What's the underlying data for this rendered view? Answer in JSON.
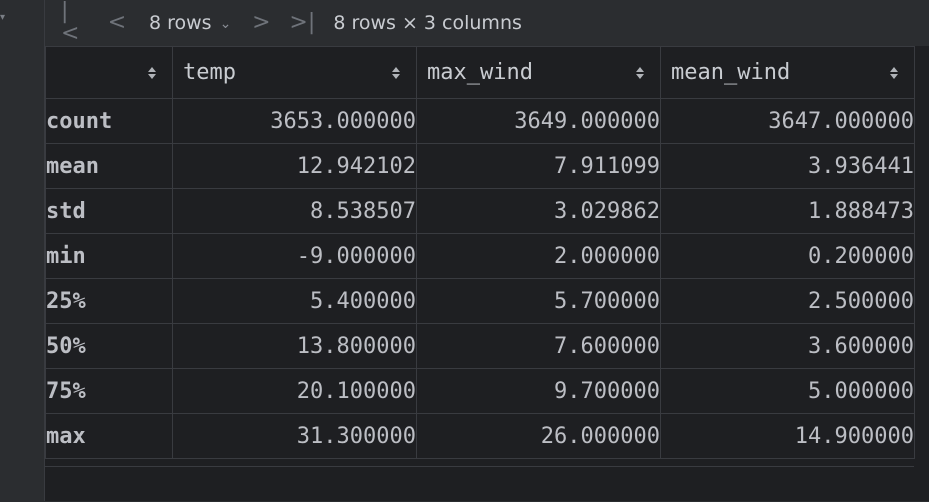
{
  "toolbar": {
    "first_icon": "|<",
    "prev_icon": "<",
    "rows_select": "8 rows",
    "next_icon": ">",
    "last_icon": ">|",
    "summary": "8 rows × 3 columns"
  },
  "table": {
    "columns": [
      "temp",
      "max_wind",
      "mean_wind"
    ],
    "rows": [
      {
        "label": "count",
        "values": [
          "3653.000000",
          "3649.000000",
          "3647.000000"
        ]
      },
      {
        "label": "mean",
        "values": [
          "12.942102",
          "7.911099",
          "3.936441"
        ]
      },
      {
        "label": "std",
        "values": [
          "8.538507",
          "3.029862",
          "1.888473"
        ]
      },
      {
        "label": "min",
        "values": [
          "-9.000000",
          "2.000000",
          "0.200000"
        ]
      },
      {
        "label": "25%",
        "values": [
          "5.400000",
          "5.700000",
          "2.500000"
        ]
      },
      {
        "label": "50%",
        "values": [
          "13.800000",
          "7.600000",
          "3.600000"
        ]
      },
      {
        "label": "75%",
        "values": [
          "20.100000",
          "9.700000",
          "5.000000"
        ]
      },
      {
        "label": "max",
        "values": [
          "31.300000",
          "26.000000",
          "14.900000"
        ]
      }
    ]
  }
}
